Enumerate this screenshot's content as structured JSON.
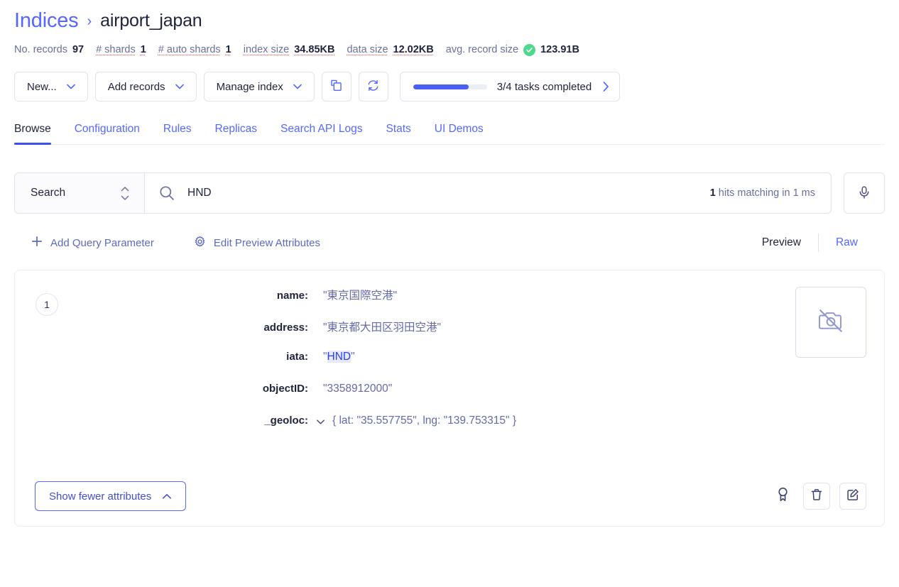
{
  "breadcrumb": {
    "parent": "Indices",
    "separator": "›",
    "current": "airport_japan"
  },
  "stats": [
    {
      "label": "No. records",
      "value": "97",
      "label_dotted": false,
      "value_dotted": false,
      "check": false
    },
    {
      "label": "# shards",
      "value": "1",
      "label_dotted": true,
      "value_dotted": true,
      "check": false
    },
    {
      "label": "# auto shards",
      "value": "1",
      "label_dotted": true,
      "value_dotted": true,
      "check": false
    },
    {
      "label": "index size",
      "value": "34.85KB",
      "label_dotted": true,
      "value_dotted": true,
      "check": false
    },
    {
      "label": "data size",
      "value": "12.02KB",
      "label_dotted": true,
      "value_dotted": true,
      "check": false
    },
    {
      "label": "avg. record size",
      "value": "123.91B",
      "label_dotted": false,
      "value_dotted": false,
      "check": true
    }
  ],
  "toolbar": {
    "new_label": "New...",
    "add_records_label": "Add records",
    "manage_index_label": "Manage index",
    "copy_icon": "copy-icon",
    "refresh_icon": "refresh-icon",
    "tasks": {
      "text": "3/4 tasks completed",
      "completed": 3,
      "total": 4,
      "percent": 75,
      "bar_color": "#4a5ef0",
      "track_color": "#eceef5"
    }
  },
  "tabs": [
    {
      "label": "Browse",
      "active": true
    },
    {
      "label": "Configuration",
      "active": false
    },
    {
      "label": "Rules",
      "active": false
    },
    {
      "label": "Replicas",
      "active": false
    },
    {
      "label": "Search API Logs",
      "active": false
    },
    {
      "label": "Stats",
      "active": false
    },
    {
      "label": "UI Demos",
      "active": false
    }
  ],
  "search": {
    "mode_label": "Search",
    "query": "HND",
    "placeholder": "Search",
    "hits_count": "1",
    "hits_text": "hits matching in 1 ms",
    "search_icon": "search-icon",
    "mic_icon": "microphone-icon"
  },
  "options": {
    "add_query_parameter": "Add Query Parameter",
    "edit_preview_attributes": "Edit Preview Attributes",
    "plus_icon": "plus-icon",
    "gear_icon": "gear-icon",
    "view_preview": "Preview",
    "view_raw": "Raw",
    "view_active": "Preview"
  },
  "record": {
    "index_number": "1",
    "attributes": [
      {
        "key": "name:",
        "value": "\"東京国際空港\"",
        "collapsible": false,
        "highlight": null
      },
      {
        "key": "address:",
        "value": "\"東京都大田区羽田空港\"",
        "collapsible": false,
        "highlight": null
      },
      {
        "key": "iata:",
        "value": "\"HND\"",
        "collapsible": false,
        "highlight": "HND"
      },
      {
        "key": "objectID:",
        "value": "\"3358912000\"",
        "collapsible": false,
        "highlight": null
      },
      {
        "key": "_geoloc:",
        "value": "{ lat: \"35.557755\", lng: \"139.753315\" }",
        "collapsible": true,
        "highlight": null
      }
    ],
    "image_placeholder_icon": "no-image-icon",
    "show_fewer_label": "Show fewer attributes",
    "actions": [
      {
        "icon": "ribbon-icon",
        "boxed": false
      },
      {
        "icon": "trash-icon",
        "boxed": true
      },
      {
        "icon": "edit-icon",
        "boxed": true
      }
    ]
  },
  "colors": {
    "accent": "#5468ff",
    "text": "#21243d",
    "muted": "#6a6f9c",
    "success": "#4dd98b",
    "highlight_bg": "#e6e9fd"
  }
}
